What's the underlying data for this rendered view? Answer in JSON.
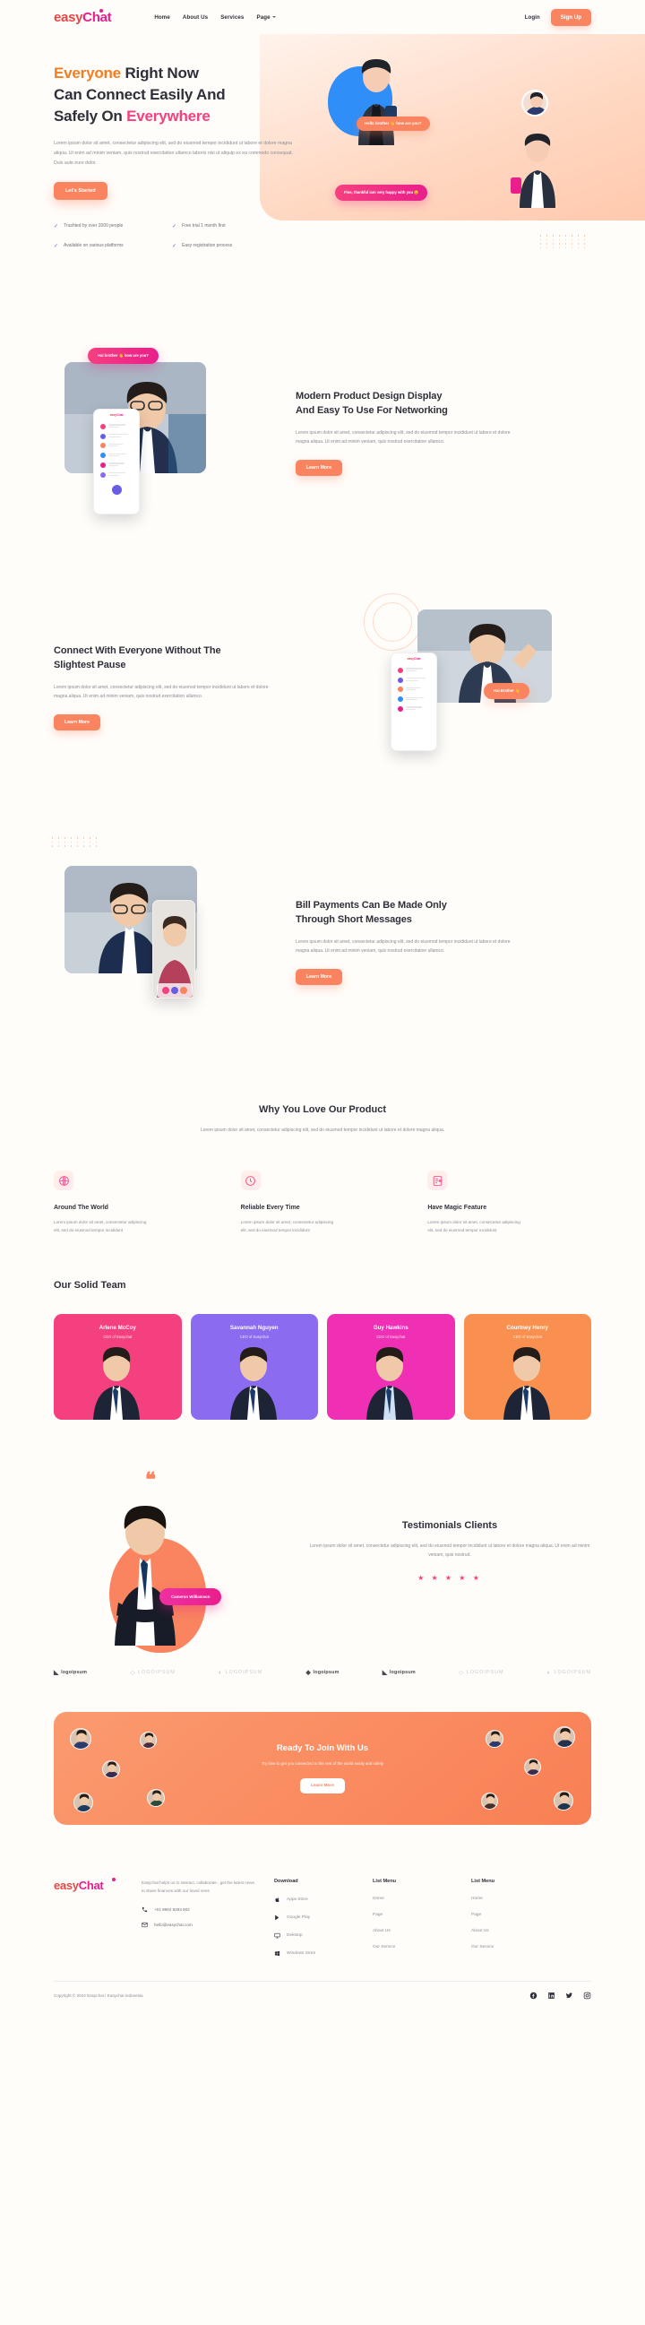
{
  "brand": {
    "name_part1": "easy",
    "name_part2": "Chat",
    "accent_orange": "#f9845f",
    "accent_pink": "#e91e8c",
    "accent_purple": "#6b5ce7"
  },
  "nav": {
    "links": [
      {
        "label": "Home"
      },
      {
        "label": "About Us"
      },
      {
        "label": "Services"
      },
      {
        "label": "Page"
      }
    ],
    "login_label": "Login",
    "signup_label": "Sign Up"
  },
  "hero": {
    "title_1": "Everyone",
    "title_2": " Right Now",
    "title_3": "Can Connect Easily And",
    "title_4": "Safely On ",
    "title_5": "Everywhere",
    "paragraph": "Lorem ipsum dolor sit amet, consectetur adipiscing elit, sed do eiusmod tempor incididunt ut labore et dolore magna aliqua. Ut enim ad minim veniam, quis nostrud exercitation ullamco laboris nisi ut aliquip ex ea commodo consequat. Duis aute irure dolor.",
    "cta_label": "Let's Started",
    "bubble_orange": "Hello brother 👋 how are you?",
    "bubble_pink": "Fine, thankful iam very happy with you 😊",
    "checks": [
      {
        "label": "Trushted by over 2000 people"
      },
      {
        "label": "Free trial 1 month first"
      },
      {
        "label": "Available on various platforms"
      },
      {
        "label": "Easy registration process"
      }
    ]
  },
  "section_modern": {
    "title_line1": "Modern Product Design Display",
    "title_line2": "And Easy To Use For Networking",
    "paragraph": "Lorem ipsum dolor sit amet, consectetur adipiscing elit, sed do eiusmod tempor incididunt ut labore et dolore magna aliqua. Ut enim ad minim veniam, quis nostrud exercitation ullamco.",
    "cta_label": "Learn More",
    "bubble": "Hai brother 👋 how are you?"
  },
  "section_connect": {
    "title_line1": "Connect With Everyone Without The",
    "title_line2": "Slightest Pause",
    "paragraph": "Lorem ipsum dolor sit amet, consectetur adipiscing elit, sed do eiusmod tempor incididunt ut labore et dolore magna aliqua. Ut enim ad minim veniam, quis nostrud exercitation ullamco.",
    "cta_label": "Learn More",
    "bubble": "Hai Brother 👋"
  },
  "section_bill": {
    "title_line1": "Bill Payments Can Be Made Only",
    "title_line2": "Through Short Messages",
    "paragraph": "Lorem ipsum dolor sit amet, consectetur adipiscing elit, sed do eiusmod tempor incididunt ut labore et dolore magna aliqua. Ut enim ad minim veniam, quis nostrud exercitation ullamco.",
    "cta_label": "Learn More"
  },
  "why": {
    "title": "Why You Love Our Product",
    "subtitle": "Lorem ipsum dolor sit amet, consectetur adipiscing elit, sed do eiusmod tempor incididunt ut labore et dolore magna aliqua.",
    "cards": [
      {
        "icon": "globe-grid-icon",
        "title": "Around The World",
        "text": "Lorem ipsum dolor sit amet, consectetur adipiscing elit, sed do eiusmod tempor incididunt"
      },
      {
        "icon": "clock-24-icon",
        "title": "Reliable Every Time",
        "text": "Lorem ipsum dolor sit amet, consectetur adipiscing elit, sed do eiusmod tempor incididunt"
      },
      {
        "icon": "document-key-icon",
        "title": "Have Magic Feature",
        "text": "Lorem ipsum dolor sit amet, consectetur adipiscing elit, sed do eiusmod tempor incididunt"
      }
    ]
  },
  "team": {
    "title": "Our Solid Team",
    "members": [
      {
        "name": "Arlene McCoy",
        "role": "CEO of Easychat",
        "color": "#f5407f"
      },
      {
        "name": "Savannah Nguyen",
        "role": "CEO of Easychat",
        "color": "#8b6bf0"
      },
      {
        "name": "Guy Hawkins",
        "role": "CEO of Easychat",
        "color": "#ef30b5"
      },
      {
        "name": "Courtney Henry",
        "role": "CEO of Easychat",
        "color": "#f9904f"
      }
    ]
  },
  "testimonial": {
    "title": "Testimonials Clients",
    "paragraph": "Lorem ipsum dolor sit amet, consectetur adipiscing elit, sed do eiusmod tempor incididunt ut labore et dolore magna aliqua. Ut enim ad minim veniam, quis nostrud.",
    "person_name": "Cameron Williamson",
    "rating": 5,
    "stars": "★ ★ ★ ★ ★",
    "quote_glyph": "❝"
  },
  "logos": [
    {
      "text": "logoipsum",
      "style": "dark"
    },
    {
      "text": "LOGOIPSUM",
      "style": "faded"
    },
    {
      "text": "LOGOIPSUM",
      "style": "faded"
    },
    {
      "text": "logoipsum",
      "style": "dark"
    },
    {
      "text": "logoipsum",
      "style": "dark"
    },
    {
      "text": "LOGOIPSUM",
      "style": "faded"
    },
    {
      "text": "LOGOIPSUM",
      "style": "faded"
    }
  ],
  "cta": {
    "title": "Ready To Join With Us",
    "text": "Try time to get you connected to the rest of the world easily and safely",
    "button_label": "Learn More"
  },
  "footer": {
    "about": "Easychat helps us to interact, collaborate , get the latest news to share finances with our loved ones",
    "phone": "+01 9992 8293 902",
    "email": "hello@easychat.com",
    "columns": [
      {
        "heading": "Download",
        "items": [
          {
            "label": "Apps Store",
            "icon": "apple-icon"
          },
          {
            "label": "Google Play",
            "icon": "play-icon"
          },
          {
            "label": "Dekstop",
            "icon": "monitor-icon"
          },
          {
            "label": "Windows Store",
            "icon": "windows-icon"
          }
        ]
      },
      {
        "heading": "List Menu",
        "items": [
          {
            "label": "Home",
            "icon": ""
          },
          {
            "label": "Page",
            "icon": ""
          },
          {
            "label": "About Us",
            "icon": ""
          },
          {
            "label": "Our Service",
            "icon": ""
          }
        ]
      },
      {
        "heading": "List Menu",
        "items": [
          {
            "label": "Home",
            "icon": ""
          },
          {
            "label": "Page",
            "icon": ""
          },
          {
            "label": "About Us",
            "icon": ""
          },
          {
            "label": "Our Service",
            "icon": ""
          }
        ]
      }
    ],
    "copyright": "Copyright © 2024 Easychat | Easychat indonesia",
    "socials": [
      "facebook-icon",
      "linkedin-icon",
      "twitter-icon",
      "instagram-icon"
    ]
  }
}
